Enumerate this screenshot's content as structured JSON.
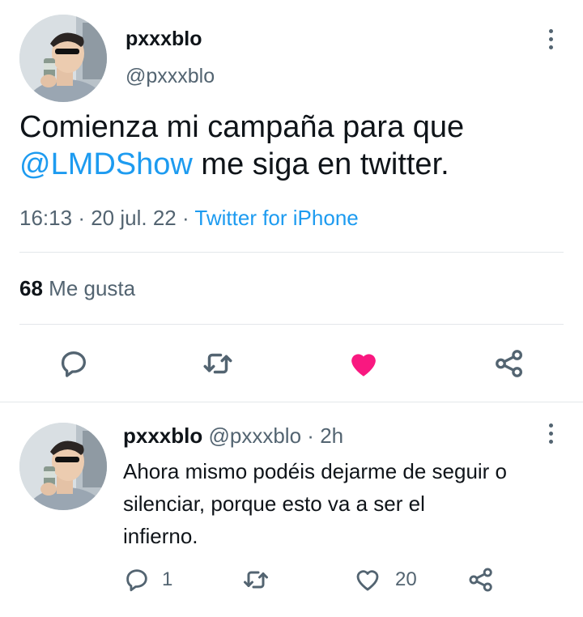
{
  "main_tweet": {
    "author_name": "pxxxblo",
    "author_handle": "@pxxxblo",
    "text_line1": "Comienza mi campaña para que",
    "mention": "@LMDShow",
    "text_line2_rest": " me siga en twitter.",
    "time": "16:13",
    "separator": "·",
    "date": "20 jul. 22",
    "source": "Twitter for iPhone",
    "likes_count": "68",
    "likes_label": "Me gusta",
    "liked": true
  },
  "reply_tweet": {
    "author_name": "pxxxblo",
    "author_handle": "@pxxxblo",
    "separator": "·",
    "time_ago": "2h",
    "text_line1": "Ahora mismo podéis dejarme de seguir o",
    "text_line2": "silenciar, porque esto va a ser el",
    "text_line3": "infierno.",
    "reply_count": "1",
    "like_count": "20"
  },
  "colors": {
    "link": "#1d9bf0",
    "like_active": "#f91880",
    "muted": "#536471",
    "text": "#0f1419"
  },
  "icons": [
    "more-icon",
    "reply-icon",
    "retweet-icon",
    "heart-icon",
    "share-icon"
  ]
}
